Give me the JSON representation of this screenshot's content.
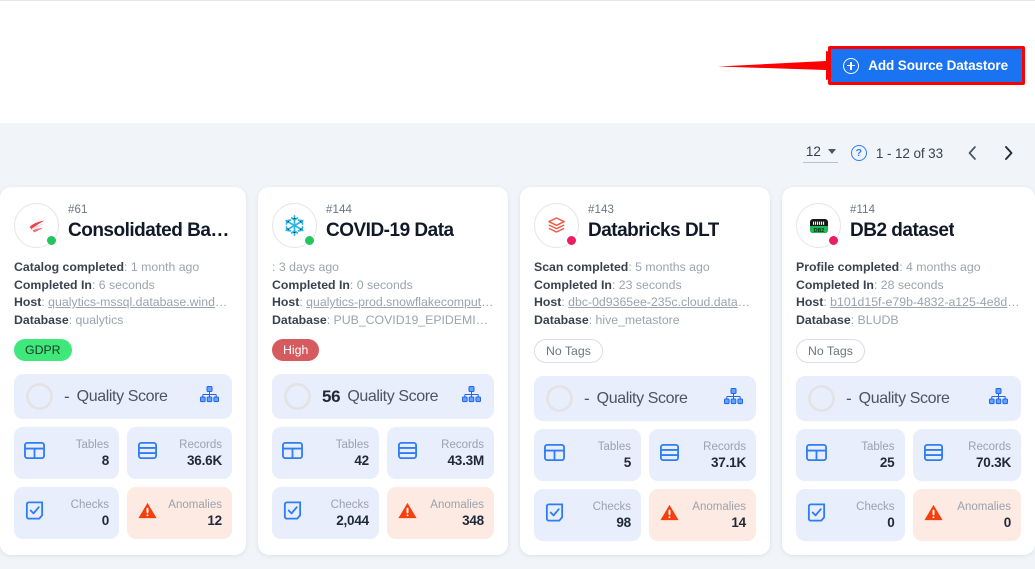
{
  "header": {
    "add_button_label": "Add Source Datastore",
    "add_button_icon": "plus-circle-icon",
    "accent_color": "#1a73f0",
    "highlight_color": "#ff0000",
    "arrow_annotation_color": "#ff0000"
  },
  "pagination": {
    "page_size": "12",
    "help_icon": "question-mark-icon",
    "range_label": "1 - 12 of 33",
    "prev_icon": "chevron-left-icon",
    "next_icon": "chevron-right-icon"
  },
  "labels": {
    "quality_score": "Quality Score",
    "tables": "Tables",
    "records": "Records",
    "checks": "Checks",
    "anomalies": "Anomalies",
    "host": "Host",
    "database": "Database",
    "completed_in": "Completed In",
    "tree_icon": "hierarchy-icon",
    "tables_icon": "table-grid-icon",
    "records_icon": "records-stack-icon",
    "checks_icon": "checkbox-check-icon",
    "anomalies_icon": "warning-triangle-icon"
  },
  "cards": [
    {
      "id": "#61",
      "title": "Consolidated Bala…",
      "icon": "mssql-icon",
      "status_dot": "green",
      "status_line_label": "Catalog completed",
      "status_line_value": "1 month ago",
      "completed_in_value": "6 seconds",
      "host_value": "qualytics-mssql.database.window…",
      "database_value": "qualytics",
      "tag": "GDPR",
      "tag_style": "gdpr",
      "quality_score": "-",
      "quality_score_pct": 0,
      "tables": "8",
      "records": "36.6K",
      "checks": "0",
      "anomalies": "12"
    },
    {
      "id": "#144",
      "title": "COVID-19 Data",
      "icon": "snowflake-icon",
      "status_dot": "green",
      "status_line_label": "",
      "status_line_value": "3 days ago",
      "completed_in_value": "0 seconds",
      "host_value": "qualytics-prod.snowflakecomputi…",
      "database_value": "PUB_COVID19_EPIDEMIOLO…",
      "tag": "High",
      "tag_style": "high",
      "quality_score": "56",
      "quality_score_pct": 56,
      "tables": "42",
      "records": "43.3M",
      "checks": "2,044",
      "anomalies": "348"
    },
    {
      "id": "#143",
      "title": "Databricks DLT",
      "icon": "databricks-icon",
      "status_dot": "pink",
      "status_line_label": "Scan completed",
      "status_line_value": "5 months ago",
      "completed_in_value": "23 seconds",
      "host_value": "dbc-0d9365ee-235c.cloud.databr…",
      "database_value": "hive_metastore",
      "tag": "No Tags",
      "tag_style": "none",
      "quality_score": "-",
      "quality_score_pct": 0,
      "tables": "5",
      "records": "37.1K",
      "checks": "98",
      "anomalies": "14"
    },
    {
      "id": "#114",
      "title": "DB2 dataset",
      "icon": "db2-icon",
      "status_dot": "pink",
      "status_line_label": "Profile completed",
      "status_line_value": "4 months ago",
      "completed_in_value": "28 seconds",
      "host_value": "b101d15f-e79b-4832-a125-4e8d4…",
      "database_value": "BLUDB",
      "tag": "No Tags",
      "tag_style": "none",
      "quality_score": "-",
      "quality_score_pct": 0,
      "tables": "25",
      "records": "70.3K",
      "checks": "0",
      "anomalies": "0"
    }
  ]
}
